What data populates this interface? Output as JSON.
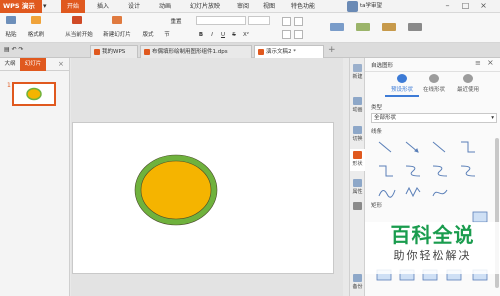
{
  "app_button": "WPS 演示",
  "menu": [
    "开始",
    "插入",
    "设计",
    "动画",
    "幻灯片放映",
    "审阅",
    "视图",
    "特色功能"
  ],
  "user": "ta学审望",
  "ribbon": {
    "paste": "粘贴",
    "format_painter": "格式刷",
    "from_current": "从当前开始",
    "new_slide": "新建幻灯片",
    "layout": "版式",
    "section": "节",
    "reset": "重置",
    "bold": "B",
    "italic": "I",
    "underline": "U",
    "strike": "S",
    "superscript": "X²"
  },
  "tabs": [
    "我的WPS",
    "布偶填形绘制用图形组件1.dps",
    "演示文稿2 *"
  ],
  "left_panel": {
    "tabs": [
      "大纲",
      "幻灯片"
    ],
    "slide_number": "1"
  },
  "slide_shape": {
    "fill": "#f5b400",
    "stroke": "#6fb23d",
    "shape": "ellipse"
  },
  "sidebar": [
    "新建",
    "动画",
    "切换",
    "形状",
    "属性",
    "备份"
  ],
  "right_pane": {
    "header": "自选图形",
    "close": "×",
    "top_tabs": [
      "预设形状",
      "在线形状",
      "最近使用"
    ],
    "type_label": "类型",
    "type_value": "全部形状",
    "lines_label": "线条",
    "rect_label": "矩形"
  },
  "watermark": {
    "title": "百科全说",
    "subtitle": "助你轻松解决"
  },
  "colors": {
    "accent": "#e0591f",
    "blue": "#3d7bd6",
    "watermark_green": "#1a9c4e"
  }
}
